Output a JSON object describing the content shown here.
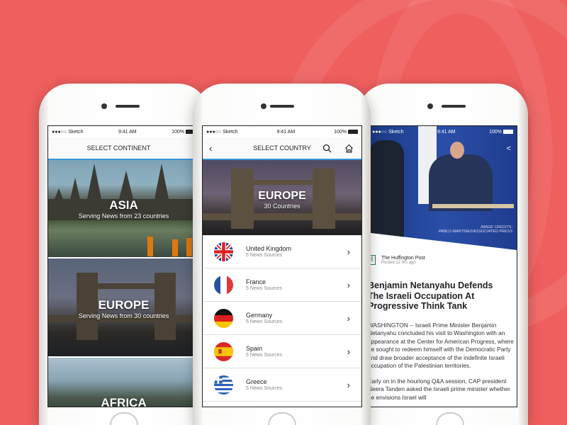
{
  "status": {
    "carrier": "●●●○○ Sketch",
    "time": "9:41 AM",
    "battery": "100%"
  },
  "continents_screen": {
    "title": "SELECT CONTINENT",
    "items": [
      {
        "name": "ASIA",
        "subtitle": "Serving News from 23 countries"
      },
      {
        "name": "EUROPE",
        "subtitle": "Serving News from 30 countries"
      },
      {
        "name": "AFRICA",
        "subtitle": ""
      }
    ]
  },
  "countries_screen": {
    "title": "SELECT COUNTRY",
    "back_icon": "chevron-left-icon",
    "search_icon": "search-icon",
    "home_icon": "home-icon",
    "hero": {
      "title": "EUROPE",
      "subtitle": "30 Countries"
    },
    "countries": [
      {
        "name": "United Kingdom",
        "sources": "5 News Sources"
      },
      {
        "name": "France",
        "sources": "5 News Sources"
      },
      {
        "name": "Germany",
        "sources": "5 News Sources"
      },
      {
        "name": "Spain",
        "sources": "5 News Sources"
      },
      {
        "name": "Greece",
        "sources": "5 News Sources"
      }
    ]
  },
  "article_screen": {
    "share_icon": "share-icon",
    "image_credit_label": "IMAGE CREDITS:",
    "image_credit": "PABLO MARTINEZ/ASSOCIATED PRESS",
    "source_logo": "H",
    "source": "The Huffington Post",
    "posted": "Posted 12 hrs ago",
    "headline": "Benjamin Netanyahu Defends The Israeli Occupation At Progressive Think Tank",
    "paragraphs": [
      "WASHINGTON -- Israeli Prime Minister Benjamin Netanyahu concluded his visit to Washington with an appearance at the Center for American Progress, where he sought to redeem himself with the Democratic Party and draw broader acceptance of the indefinite Israeli occupation of the Palestinian territories.",
      "Early on in the hourlong Q&A session, CAP president Neera Tanden asked the Israeli prime minister whether he envisions Israel will"
    ]
  },
  "colors": {
    "background": "#ef5f5e",
    "accent": "#3a95d8"
  }
}
